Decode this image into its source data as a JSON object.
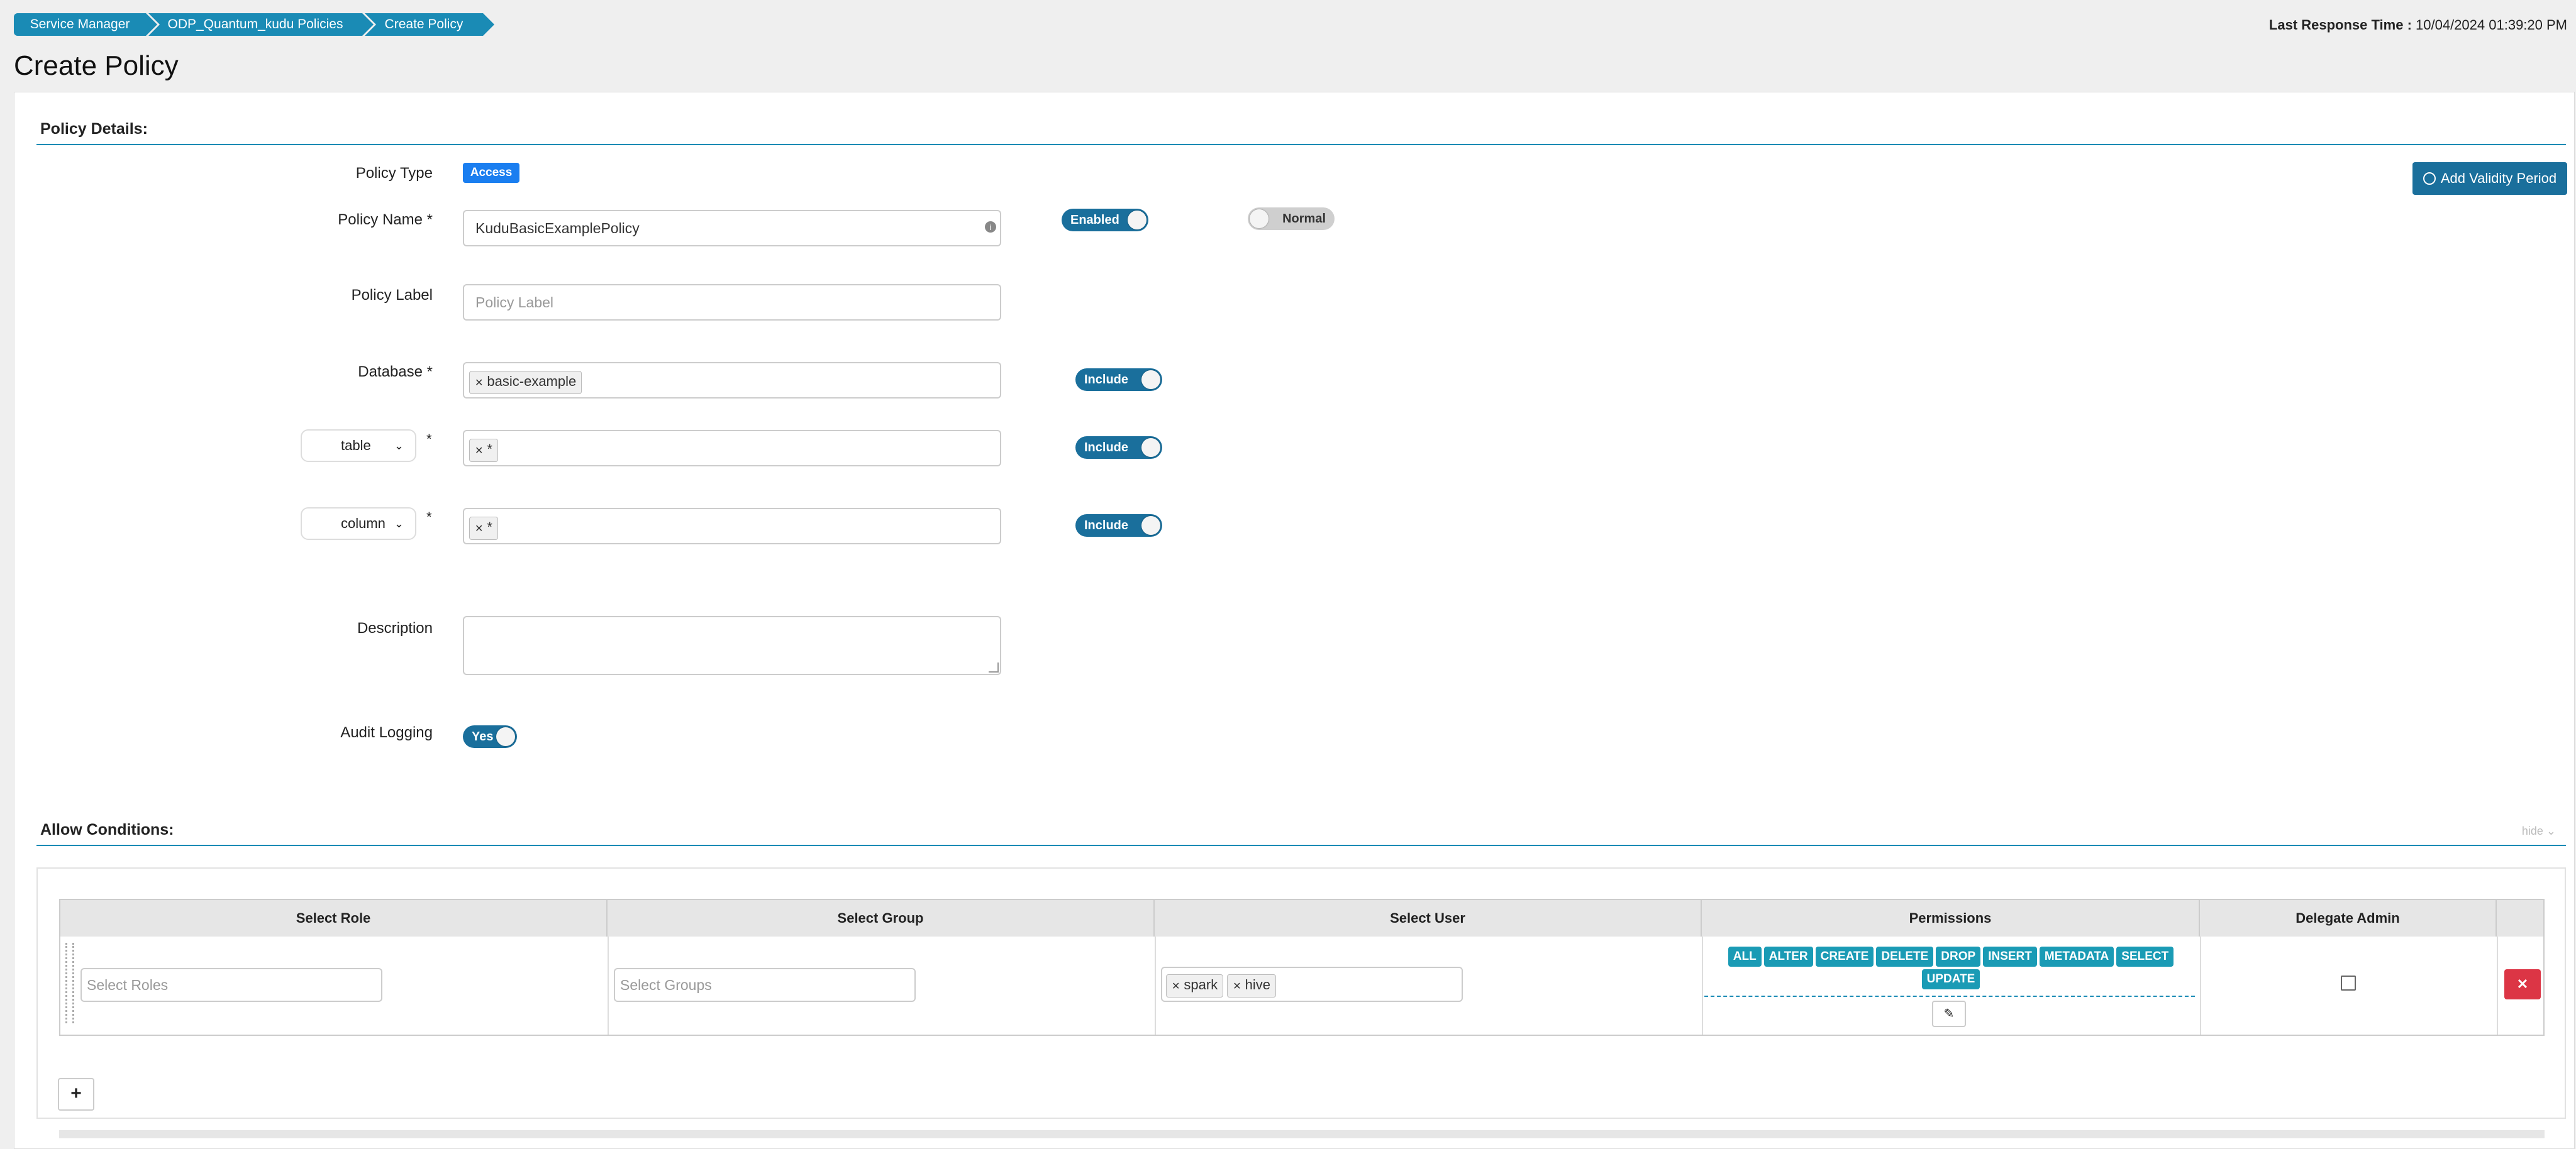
{
  "breadcrumb": [
    "Service Manager",
    "ODP_Quantum_kudu Policies",
    "Create Policy"
  ],
  "header": {
    "response_label": "Last Response Time :",
    "response_value": "10/04/2024 01:39:20 PM",
    "title": "Create Policy"
  },
  "policy_details": {
    "section_title": "Policy Details:",
    "policy_type_label": "Policy Type",
    "policy_type_badge": "Access",
    "add_validity_label": "Add Validity Period",
    "policy_name_label": "Policy Name *",
    "policy_name_value": "KuduBasicExamplePolicy",
    "enabled_toggle": "Enabled",
    "normal_toggle": "Normal",
    "policy_label_label": "Policy Label",
    "policy_label_placeholder": "Policy Label",
    "database_label": "Database *",
    "database_tag": "basic-example",
    "include_label": "Include",
    "table_select": "table",
    "table_tag": "*",
    "column_select": "column",
    "column_tag": "*",
    "required_star": "*",
    "description_label": "Description",
    "audit_label": "Audit Logging",
    "audit_toggle": "Yes"
  },
  "allow": {
    "section_title": "Allow Conditions:",
    "hide_label": "hide",
    "headers": [
      "Select Role",
      "Select Group",
      "Select User",
      "Permissions",
      "Delegate Admin"
    ],
    "roles_placeholder": "Select Roles",
    "groups_placeholder": "Select Groups",
    "users": [
      "spark",
      "hive"
    ],
    "permissions": [
      "ALL",
      "ALTER",
      "CREATE",
      "DELETE",
      "DROP",
      "INSERT",
      "METADATA",
      "SELECT",
      "UPDATE"
    ],
    "add_label": "+"
  },
  "icons": [
    "info-icon",
    "clock-icon",
    "chevron-down-icon",
    "pencil-icon",
    "close-icon",
    "remove-x-icon",
    "drag-handle-icon",
    "resize-icon"
  ],
  "colors": {
    "primary": "#1a8bb5",
    "toggle": "#1a6f9c",
    "badge": "#1a7ef0",
    "perm": "#1a9bb5",
    "danger": "#dc3545"
  }
}
